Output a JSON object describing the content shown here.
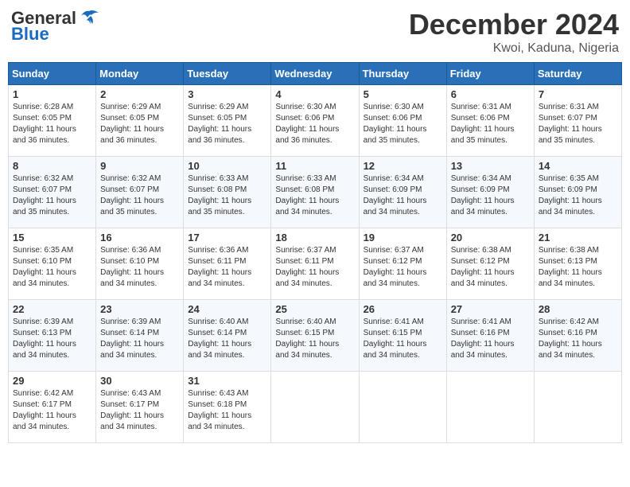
{
  "logo": {
    "text_general": "General",
    "text_blue": "Blue"
  },
  "title": "December 2024",
  "location": "Kwoi, Kaduna, Nigeria",
  "days_of_week": [
    "Sunday",
    "Monday",
    "Tuesday",
    "Wednesday",
    "Thursday",
    "Friday",
    "Saturday"
  ],
  "weeks": [
    [
      {
        "day": "1",
        "sunrise": "6:28 AM",
        "sunset": "6:05 PM",
        "daylight": "11 hours and 36 minutes."
      },
      {
        "day": "2",
        "sunrise": "6:29 AM",
        "sunset": "6:05 PM",
        "daylight": "11 hours and 36 minutes."
      },
      {
        "day": "3",
        "sunrise": "6:29 AM",
        "sunset": "6:05 PM",
        "daylight": "11 hours and 36 minutes."
      },
      {
        "day": "4",
        "sunrise": "6:30 AM",
        "sunset": "6:06 PM",
        "daylight": "11 hours and 36 minutes."
      },
      {
        "day": "5",
        "sunrise": "6:30 AM",
        "sunset": "6:06 PM",
        "daylight": "11 hours and 35 minutes."
      },
      {
        "day": "6",
        "sunrise": "6:31 AM",
        "sunset": "6:06 PM",
        "daylight": "11 hours and 35 minutes."
      },
      {
        "day": "7",
        "sunrise": "6:31 AM",
        "sunset": "6:07 PM",
        "daylight": "11 hours and 35 minutes."
      }
    ],
    [
      {
        "day": "8",
        "sunrise": "6:32 AM",
        "sunset": "6:07 PM",
        "daylight": "11 hours and 35 minutes."
      },
      {
        "day": "9",
        "sunrise": "6:32 AM",
        "sunset": "6:07 PM",
        "daylight": "11 hours and 35 minutes."
      },
      {
        "day": "10",
        "sunrise": "6:33 AM",
        "sunset": "6:08 PM",
        "daylight": "11 hours and 35 minutes."
      },
      {
        "day": "11",
        "sunrise": "6:33 AM",
        "sunset": "6:08 PM",
        "daylight": "11 hours and 34 minutes."
      },
      {
        "day": "12",
        "sunrise": "6:34 AM",
        "sunset": "6:09 PM",
        "daylight": "11 hours and 34 minutes."
      },
      {
        "day": "13",
        "sunrise": "6:34 AM",
        "sunset": "6:09 PM",
        "daylight": "11 hours and 34 minutes."
      },
      {
        "day": "14",
        "sunrise": "6:35 AM",
        "sunset": "6:09 PM",
        "daylight": "11 hours and 34 minutes."
      }
    ],
    [
      {
        "day": "15",
        "sunrise": "6:35 AM",
        "sunset": "6:10 PM",
        "daylight": "11 hours and 34 minutes."
      },
      {
        "day": "16",
        "sunrise": "6:36 AM",
        "sunset": "6:10 PM",
        "daylight": "11 hours and 34 minutes."
      },
      {
        "day": "17",
        "sunrise": "6:36 AM",
        "sunset": "6:11 PM",
        "daylight": "11 hours and 34 minutes."
      },
      {
        "day": "18",
        "sunrise": "6:37 AM",
        "sunset": "6:11 PM",
        "daylight": "11 hours and 34 minutes."
      },
      {
        "day": "19",
        "sunrise": "6:37 AM",
        "sunset": "6:12 PM",
        "daylight": "11 hours and 34 minutes."
      },
      {
        "day": "20",
        "sunrise": "6:38 AM",
        "sunset": "6:12 PM",
        "daylight": "11 hours and 34 minutes."
      },
      {
        "day": "21",
        "sunrise": "6:38 AM",
        "sunset": "6:13 PM",
        "daylight": "11 hours and 34 minutes."
      }
    ],
    [
      {
        "day": "22",
        "sunrise": "6:39 AM",
        "sunset": "6:13 PM",
        "daylight": "11 hours and 34 minutes."
      },
      {
        "day": "23",
        "sunrise": "6:39 AM",
        "sunset": "6:14 PM",
        "daylight": "11 hours and 34 minutes."
      },
      {
        "day": "24",
        "sunrise": "6:40 AM",
        "sunset": "6:14 PM",
        "daylight": "11 hours and 34 minutes."
      },
      {
        "day": "25",
        "sunrise": "6:40 AM",
        "sunset": "6:15 PM",
        "daylight": "11 hours and 34 minutes."
      },
      {
        "day": "26",
        "sunrise": "6:41 AM",
        "sunset": "6:15 PM",
        "daylight": "11 hours and 34 minutes."
      },
      {
        "day": "27",
        "sunrise": "6:41 AM",
        "sunset": "6:16 PM",
        "daylight": "11 hours and 34 minutes."
      },
      {
        "day": "28",
        "sunrise": "6:42 AM",
        "sunset": "6:16 PM",
        "daylight": "11 hours and 34 minutes."
      }
    ],
    [
      {
        "day": "29",
        "sunrise": "6:42 AM",
        "sunset": "6:17 PM",
        "daylight": "11 hours and 34 minutes."
      },
      {
        "day": "30",
        "sunrise": "6:43 AM",
        "sunset": "6:17 PM",
        "daylight": "11 hours and 34 minutes."
      },
      {
        "day": "31",
        "sunrise": "6:43 AM",
        "sunset": "6:18 PM",
        "daylight": "11 hours and 34 minutes."
      },
      null,
      null,
      null,
      null
    ]
  ]
}
